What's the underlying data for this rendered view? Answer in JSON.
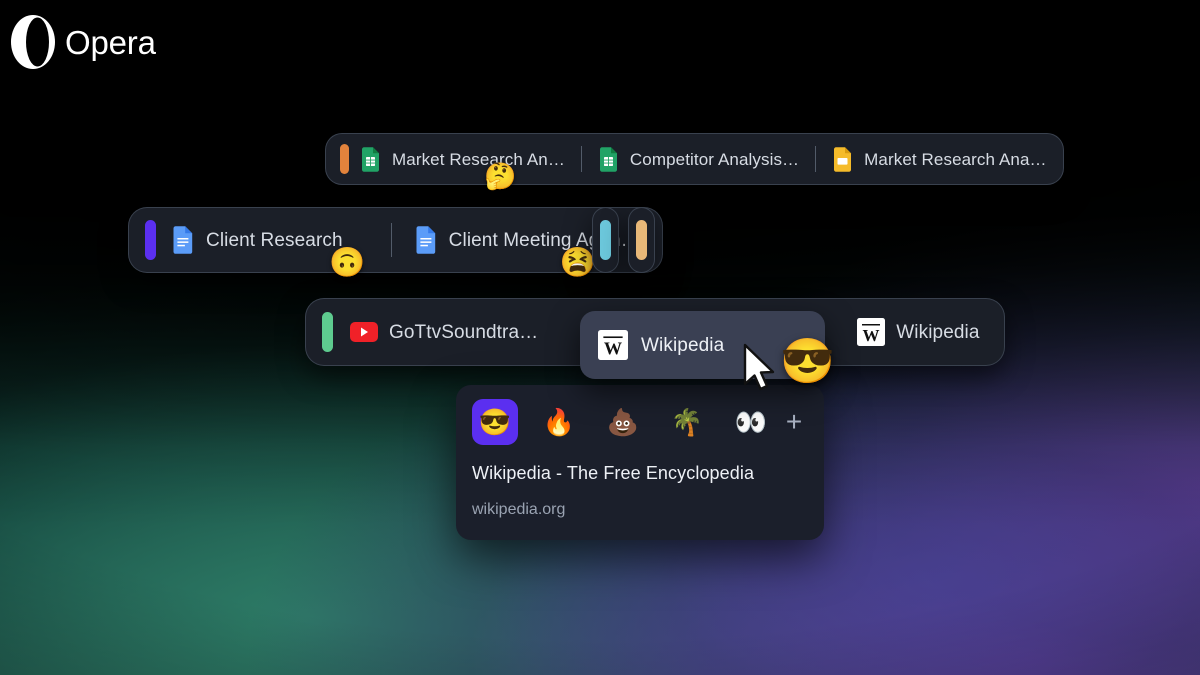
{
  "brand": {
    "name": "Opera",
    "logo_icon": "opera-logo-icon"
  },
  "theme": {
    "group_bg": "#1b1f28",
    "group_border": "rgba(128,145,170,0.30)",
    "drag_tab_bg": "#3a4053",
    "popup_bg": "#1b1f2b",
    "accent_purple": "#5b2ff0",
    "title_color": "#d7dce4",
    "url_color": "#9aa3b2"
  },
  "tab_groups": [
    {
      "id": "research-group",
      "marker_color": "#e2833c",
      "tabs": [
        {
          "title": "Market Research An…",
          "favicon": "google-sheets-icon",
          "badge": "🤔"
        },
        {
          "title": "Competitor Analysis…",
          "favicon": "google-sheets-icon",
          "badge": ""
        },
        {
          "title": "Market Research Ana…",
          "favicon": "google-slides-icon",
          "badge": ""
        }
      ]
    },
    {
      "id": "client-group",
      "marker_color": "#5b2ff0",
      "tabs": [
        {
          "title": "Client Research",
          "favicon": "google-docs-icon",
          "badge": "🙃"
        },
        {
          "title": "Client Meeting Agen…",
          "favicon": "google-docs-icon",
          "badge": "😫"
        }
      ]
    },
    {
      "id": "media-group",
      "marker_color": "#5ecb8f",
      "tabs": [
        {
          "title": "GoTtvSoundtra…",
          "favicon": "youtube-icon",
          "badge": ""
        },
        {
          "title": "Wikipedia",
          "favicon": "wikipedia-icon",
          "badge": ""
        }
      ]
    }
  ],
  "collapsed_groups": [
    {
      "id": "collapsed-group-cyan",
      "marker_color": "#6cc8dc"
    },
    {
      "id": "collapsed-group-tan",
      "marker_color": "#e8b878"
    }
  ],
  "drag_tab": {
    "title": "Wikipedia",
    "favicon": "wikipedia-icon",
    "attached_emoji": "😎"
  },
  "popup": {
    "emojis": [
      {
        "glyph": "😎",
        "name": "sunglasses-face-emoji",
        "selected": true
      },
      {
        "glyph": "🔥",
        "name": "fire-emoji",
        "selected": false
      },
      {
        "glyph": "💩",
        "name": "poop-emoji",
        "selected": false
      },
      {
        "glyph": "🌴",
        "name": "palm-tree-emoji",
        "selected": false
      },
      {
        "glyph": "👀",
        "name": "eyes-emoji",
        "selected": false
      }
    ],
    "add_label": "+",
    "title": "Wikipedia - The Free Encyclopedia",
    "url": "wikipedia.org"
  }
}
